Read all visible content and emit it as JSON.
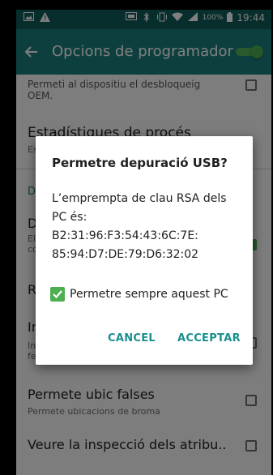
{
  "status_bar": {
    "battery_percent": "100%",
    "time": "19:44",
    "icons": [
      "gallery-icon",
      "warning-icon",
      "cast-icon",
      "bluetooth-icon",
      "vibrate-icon",
      "wifi-icon",
      "signal-icon",
      "battery-icon"
    ]
  },
  "app_bar": {
    "title": "Opcions de programador",
    "back_icon": "arrow-left-icon",
    "master_toggle_on": true
  },
  "list": {
    "oem_subtitle_1": "Permeti al dispositiu el desbloqueig",
    "oem_subtitle_2": "OEM.",
    "process_stats_title": "Estadístiques de procés",
    "process_stats_subtitle": "Es",
    "section_header": "D",
    "usb_debug_title": "D",
    "usb_debug_sub_1": "El",
    "usb_debug_sub_2": "co",
    "revoke_title": "R",
    "inspect_title": "In",
    "inspect_sub_1": "In",
    "inspect_sub_2": "fe",
    "mock_location_title": "Permete ubic falses",
    "mock_location_subtitle": "Permete ubicacions de broma",
    "view_attr_title": "Veure la inspecció dels atribu.."
  },
  "dialog": {
    "title": "Permetre depuració USB?",
    "body_line_1": "L’emprempta de clau RSA dels",
    "body_line_2": "PC és:",
    "body_line_3": "B2:31:96:F3:54:43:6C:7E:",
    "body_line_4": "85:94:D7:DE:79:D6:32:02",
    "always_allow_label": "Permetre sempre aquest PC",
    "always_allow_checked": true,
    "cancel_label": "CANCEL",
    "accept_label": "ACCEPTAR"
  },
  "colors": {
    "status_bar": "#0f5a5b",
    "app_bar": "#1a7f7f",
    "accent": "#4caf50",
    "button_text": "#1a8f8f"
  }
}
